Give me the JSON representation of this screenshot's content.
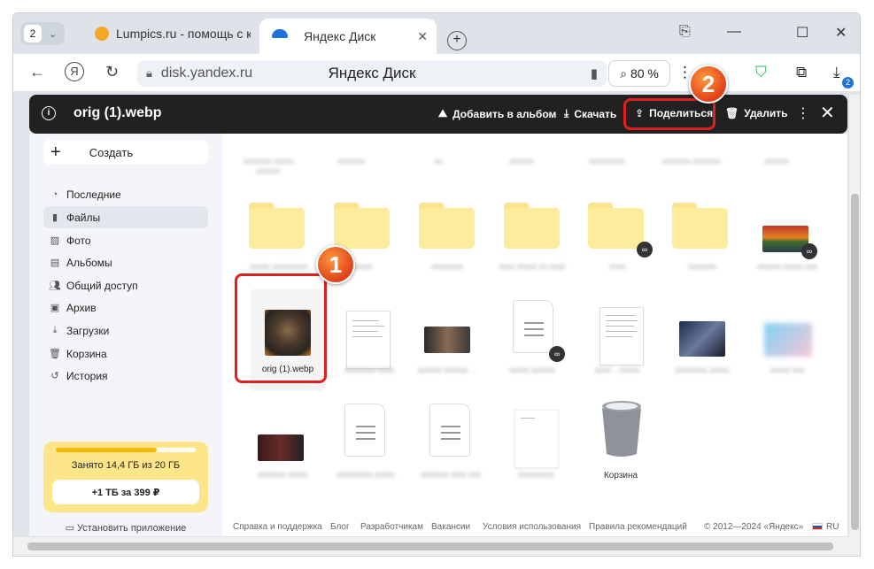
{
  "browser": {
    "tab_count": "2",
    "tabs": [
      {
        "title": "Lumpics.ru - помощь с ко",
        "favicon_color": "#f5a623"
      },
      {
        "title": "Яндекс Диск",
        "favicon_color": "#1e73d9"
      }
    ],
    "url": "disk.yandex.ru",
    "page_title": "Яндекс Диск",
    "zoom": "80 %",
    "downloads_count": "2"
  },
  "viewer": {
    "file_name": "orig (1).webp",
    "actions": {
      "add_to_album": "Добавить в альбом",
      "download": "Скачать",
      "share": "Поделиться",
      "delete": "Удалить"
    }
  },
  "sidebar": {
    "create_label": "Создать",
    "items": [
      {
        "label": "Последние",
        "icon": "clock-icon"
      },
      {
        "label": "Файлы",
        "icon": "file-icon"
      },
      {
        "label": "Фото",
        "icon": "photo-icon"
      },
      {
        "label": "Альбомы",
        "icon": "album-icon"
      },
      {
        "label": "Общий доступ",
        "icon": "shared-icon"
      },
      {
        "label": "Архив",
        "icon": "archive-icon"
      },
      {
        "label": "Загрузки",
        "icon": "download-icon"
      },
      {
        "label": "Корзина",
        "icon": "trash-icon"
      },
      {
        "label": "История",
        "icon": "history-icon"
      }
    ],
    "storage_text": "Занято 14,4 ГБ из 20 ГБ",
    "storage_used_fraction": 0.72,
    "storage_offer": "+1 ТБ за 399 ₽",
    "install_app": "Установить приложение"
  },
  "files": {
    "selected_name": "orig (1).webp",
    "trash_name": "Корзина"
  },
  "footer": {
    "help": "Справка и поддержка",
    "blog": "Блог",
    "developers": "Разработчикам",
    "jobs": "Вакансии",
    "terms": "Условия использования",
    "rules": "Правила рекомендаций",
    "copyright": "© 2012—2024 «Яндекс»",
    "lang": "RU"
  },
  "annotations": {
    "step1": "1",
    "step2": "2",
    "color": "#e02020"
  }
}
